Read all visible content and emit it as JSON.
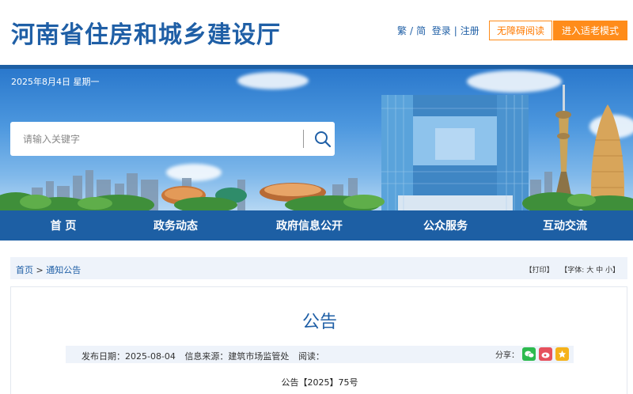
{
  "header": {
    "site_title": "河南省住房和城乡建设厅",
    "links": {
      "trad": "繁",
      "slash": "/",
      "simp": "简",
      "login": "登录",
      "bar": "|",
      "register": "注册"
    },
    "btn_accessible": "无障碍阅读",
    "btn_elder": "进入适老模式"
  },
  "banner": {
    "date": "2025年8月4日 星期一",
    "search_placeholder": "请输入关键字",
    "search_icon": "search-icon"
  },
  "nav": [
    "首 页",
    "政务动态",
    "政府信息公开",
    "公众服务",
    "互动交流"
  ],
  "breadcrumb": {
    "home": "首页",
    "sep": ">",
    "current": "通知公告",
    "print": "【打印】",
    "font_label": "【字体:",
    "font_large": "大",
    "font_medium": "中",
    "font_small": "小",
    "font_end": "】"
  },
  "article": {
    "title": "公告",
    "publish_date": "发布日期：2025-08-04",
    "source": "信息来源：建筑市场监管处",
    "reads": "阅读：",
    "share_label": "分享：",
    "doc_number": "公告【2025】75号"
  },
  "colors": {
    "brand_blue": "#1d5fa4",
    "accent_orange": "#ff8c1a",
    "wechat_green": "#2dba4e",
    "weibo_red": "#e6515d",
    "favorite_yellow": "#f5b21a"
  }
}
